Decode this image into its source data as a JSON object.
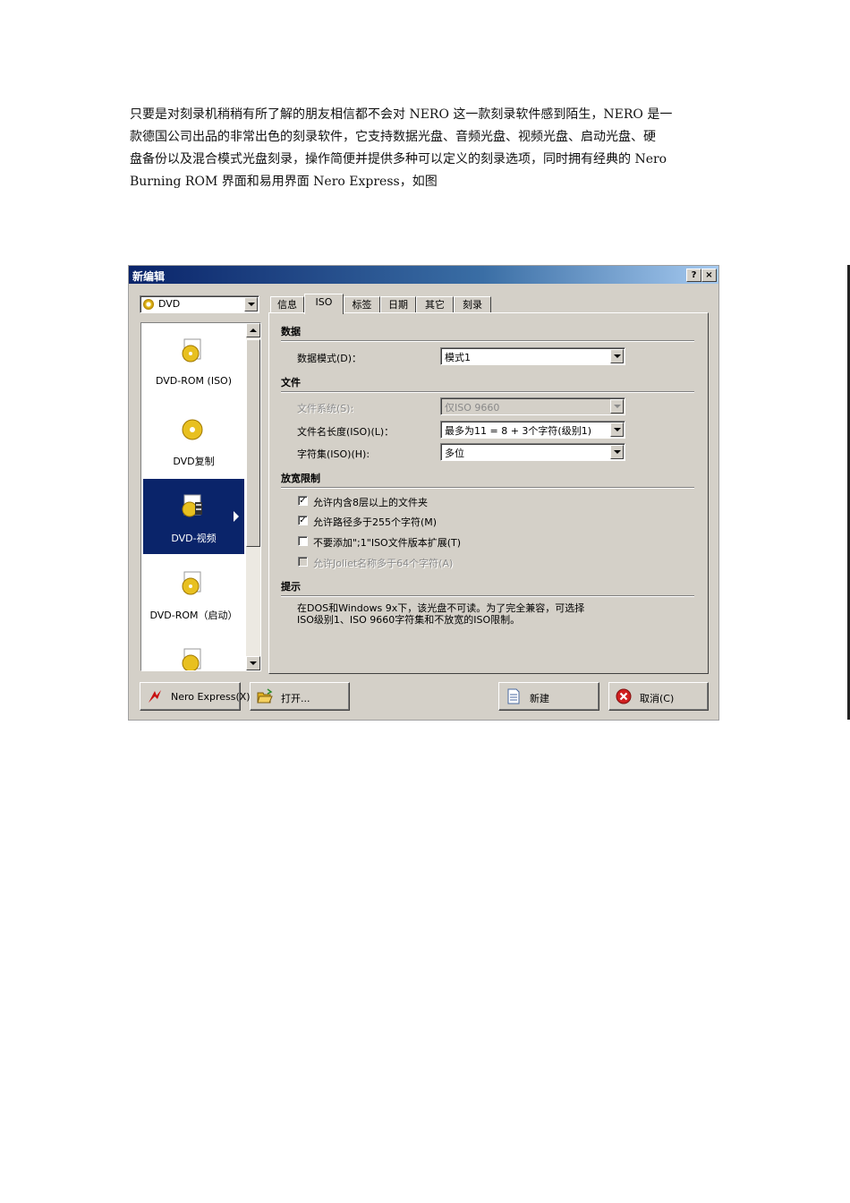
{
  "intro": {
    "line1": "只要是对刻录机稍稍有所了解的朋友相信都不会对 NERO 这一款刻录软件感到陌生，NERO 是一",
    "line2": "款德国公司出品的非常出色的刻录软件，它支持数据光盘、音频光盘、视频光盘、启动光盘、硬",
    "line3": "盘备份以及混合模式光盘刻录，操作简便并提供多种可以定义的刻录选项，同时拥有经典的 Nero",
    "line4": "Burning ROM  界面和易用界面  Nero Express，如图"
  },
  "dialog": {
    "title": "新编辑",
    "help_label": "?",
    "close_label": "×",
    "disc_type": "DVD",
    "list_items": [
      {
        "label": "DVD-ROM (ISO)"
      },
      {
        "label": "DVD复制"
      },
      {
        "label": "DVD-视频"
      },
      {
        "label": "DVD-ROM（启动）"
      }
    ],
    "tabs": [
      "信息",
      "ISO",
      "标签",
      "日期",
      "其它",
      "刻录"
    ],
    "active_tab": "ISO",
    "sections": {
      "data": "数据",
      "file": "文件",
      "relax": "放宽限制",
      "hint": "提示"
    },
    "fields": {
      "data_mode_label": "数据模式(D)：",
      "data_mode_value": "模式1",
      "file_system_label": "文件系统(S):",
      "file_system_value": "仅ISO 9660",
      "filename_length_label": "文件名长度(ISO)(L)：",
      "filename_length_value": "最多为11 = 8 + 3个字符(级别1)",
      "charset_label": "字符集(ISO)(H):",
      "charset_value": "多位"
    },
    "checkboxes": [
      {
        "label": "允许内含8层以上的文件夹",
        "checked": "✓"
      },
      {
        "label": "允许路径多于255个字符(M)",
        "checked": "✓"
      },
      {
        "label": "不要添加\";1\"ISO文件版本扩展(T)",
        "checked": ""
      },
      {
        "label": "允许Joliet名称多于64个字符(A)",
        "checked": ""
      }
    ],
    "hint_line1": "在DOS和Windows 9x下，该光盘不可读。为了完全兼容，可选择",
    "hint_line2": "ISO级别1、ISO 9660字符集和不放宽的ISO限制。",
    "buttons": {
      "nero_express": "Nero Express(X)",
      "open": "打开...",
      "new": "新建",
      "cancel": "取消(C)"
    }
  }
}
